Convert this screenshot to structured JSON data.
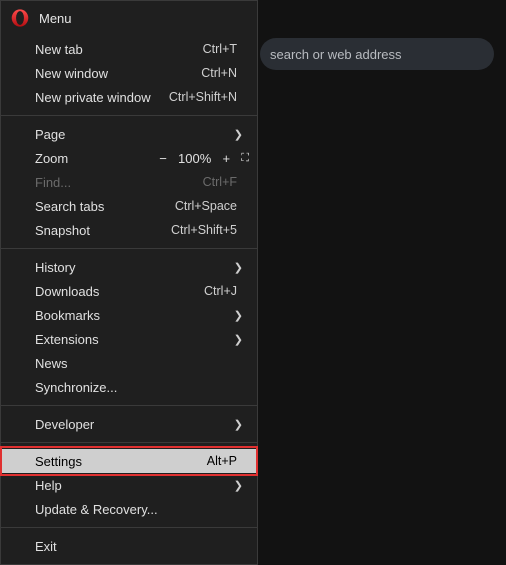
{
  "searchbar": {
    "placeholder": "search or web address"
  },
  "menu": {
    "title": "Menu",
    "items": {
      "new_tab": {
        "label": "New tab",
        "shortcut": "Ctrl+T"
      },
      "new_window": {
        "label": "New window",
        "shortcut": "Ctrl+N"
      },
      "new_private": {
        "label": "New private window",
        "shortcut": "Ctrl+Shift+N"
      },
      "page": {
        "label": "Page"
      },
      "zoom": {
        "label": "Zoom",
        "value": "100%"
      },
      "find": {
        "label": "Find...",
        "shortcut": "Ctrl+F"
      },
      "search_tabs": {
        "label": "Search tabs",
        "shortcut": "Ctrl+Space"
      },
      "snapshot": {
        "label": "Snapshot",
        "shortcut": "Ctrl+Shift+5"
      },
      "history": {
        "label": "History"
      },
      "downloads": {
        "label": "Downloads",
        "shortcut": "Ctrl+J"
      },
      "bookmarks": {
        "label": "Bookmarks"
      },
      "extensions": {
        "label": "Extensions"
      },
      "news": {
        "label": "News"
      },
      "synchronize": {
        "label": "Synchronize..."
      },
      "developer": {
        "label": "Developer"
      },
      "settings": {
        "label": "Settings",
        "shortcut": "Alt+P"
      },
      "help": {
        "label": "Help"
      },
      "update": {
        "label": "Update & Recovery..."
      },
      "exit": {
        "label": "Exit"
      }
    }
  },
  "zoom_glyphs": {
    "minus": "−",
    "plus": "+"
  }
}
